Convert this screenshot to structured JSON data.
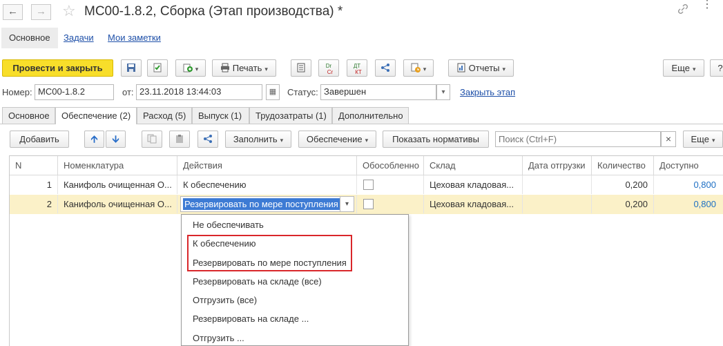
{
  "window": {
    "title": "МС00-1.8.2, Сборка (Этап производства) *"
  },
  "section_tabs": {
    "main": "Основное",
    "tasks": "Задачи",
    "notes": "Мои заметки"
  },
  "toolbar": {
    "post_close": "Провести и закрыть",
    "print": "Печать",
    "reports": "Отчеты",
    "more": "Еще",
    "help": "?",
    "dr": "Dr",
    "cr": "Cr",
    "dt": "ДТ",
    "kt": "КТ"
  },
  "fields": {
    "number_label": "Номер:",
    "number_value": "МС00-1.8.2",
    "from_label": "от:",
    "date_value": "23.11.2018 13:44:03",
    "status_label": "Статус:",
    "status_value": "Завершен",
    "close_stage": "Закрыть этап"
  },
  "page_tabs": [
    "Основное",
    "Обеспечение (2)",
    "Расход (5)",
    "Выпуск (1)",
    "Трудозатраты (1)",
    "Дополнительно"
  ],
  "sub_toolbar": {
    "add": "Добавить",
    "fill": "Заполнить",
    "provision": "Обеспечение",
    "show_norms": "Показать нормативы",
    "search_placeholder": "Поиск (Ctrl+F)",
    "clear": "×",
    "more": "Еще"
  },
  "grid": {
    "columns": [
      "N",
      "Номенклатура",
      "Действия",
      "Обособленно",
      "Склад",
      "Дата отгрузки",
      "Количество",
      "Доступно"
    ],
    "rows": [
      {
        "n": "1",
        "item": "Канифоль очищенная О...",
        "action": "К обеспечению",
        "separate": false,
        "warehouse": "Цеховая кладовая...",
        "ship_date": "",
        "qty": "0,200",
        "available": "0,800"
      },
      {
        "n": "2",
        "item": "Канифоль очищенная О...",
        "action": "Резервировать по мере поступления",
        "separate": false,
        "warehouse": "Цеховая кладовая...",
        "ship_date": "",
        "qty": "0,200",
        "available": "0,800"
      }
    ]
  },
  "dropdown": {
    "options": [
      "Не обеспечивать",
      "К обеспечению",
      "Резервировать по мере поступления",
      "Резервировать на складе (все)",
      "Отгрузить (все)",
      "Резервировать на складе ...",
      "Отгрузить ..."
    ]
  },
  "colors": {
    "primary_button": "#f8de2a",
    "selected_row": "#fbf1c8",
    "highlight_box": "#d9262a",
    "link": "#1d4fa8"
  }
}
